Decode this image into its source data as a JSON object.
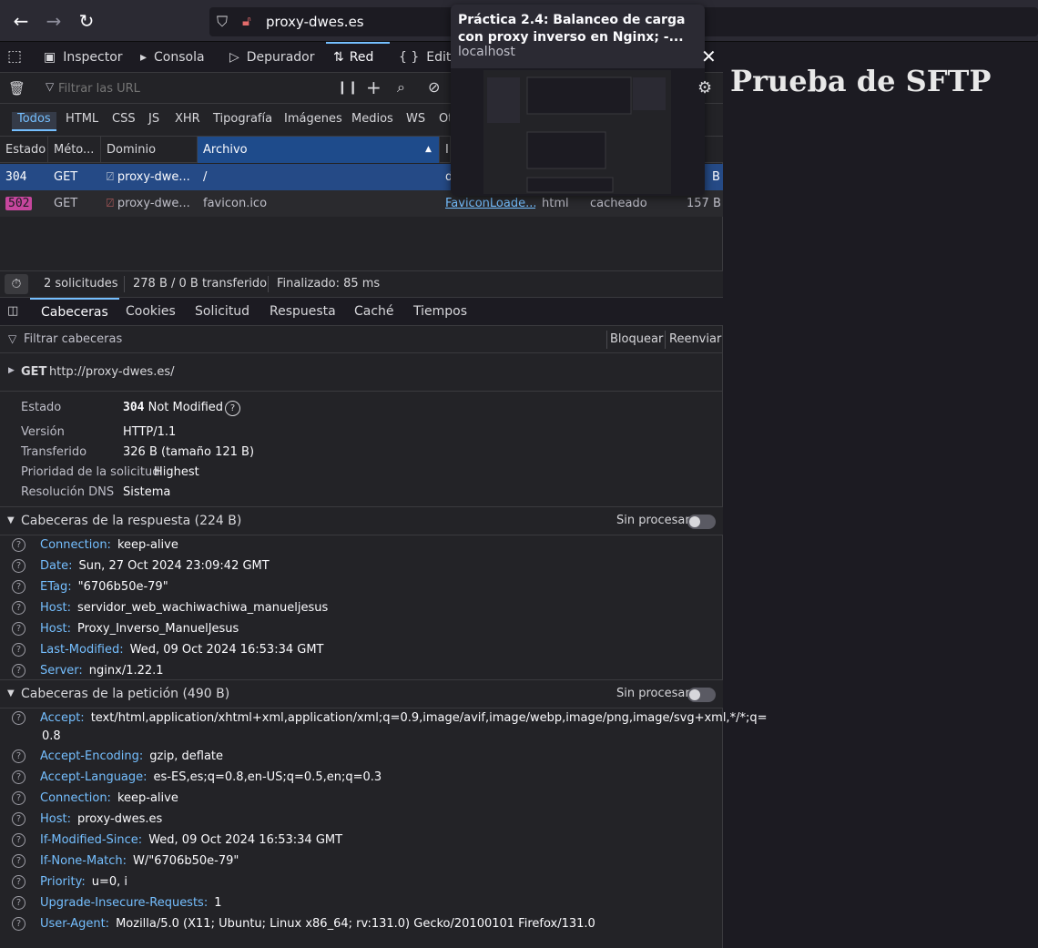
{
  "browser": {
    "url": "proxy-dwes.es",
    "preview": {
      "title": "Práctica 2.4: Balanceo de carga con proxy inverso en Nginx; -...",
      "host": "localhost"
    }
  },
  "page": {
    "title": "Prueba de SFTP"
  },
  "devtools": {
    "tabs": [
      "Inspector",
      "Consola",
      "Depurador",
      "Red",
      "Editor"
    ],
    "filter_placeholder": "Filtrar las URL",
    "types": [
      "Todos",
      "HTML",
      "CSS",
      "JS",
      "XHR",
      "Tipografía",
      "Imágenes",
      "Medios",
      "WS",
      "Otros"
    ],
    "columns": [
      "Estado",
      "Méto...",
      "Dominio",
      "Archivo",
      "In..."
    ],
    "requests": [
      {
        "status": "304",
        "method": "GET",
        "domain": "proxy-dwe...",
        "file": "/",
        "initiator": "d",
        "type": "",
        "transferred": "",
        "size": "B"
      },
      {
        "status": "502",
        "method": "GET",
        "domain": "proxy-dwe...",
        "file": "favicon.ico",
        "initiator": "FaviconLoade...",
        "type": "html",
        "transferred": "cacheado",
        "size": "157 B"
      }
    ],
    "summary": {
      "count": "2 solicitudes",
      "transfer": "278 B / 0 B transferido",
      "finished": "Finalizado: 85 ms"
    },
    "detail_tabs": [
      "Cabeceras",
      "Cookies",
      "Solicitud",
      "Respuesta",
      "Caché",
      "Tiempos"
    ],
    "header_filter": "Filtrar cabeceras",
    "block": "Bloquear",
    "resend": "Reenviar",
    "request_line": {
      "method": "GET",
      "url": "http://proxy-dwes.es/"
    },
    "info": {
      "status_label": "Estado",
      "status_code": "304",
      "status_text": "Not Modified",
      "version_label": "Versión",
      "version": "HTTP/1.1",
      "transferred_label": "Transferido",
      "transferred": "326 B (tamaño 121 B)",
      "priority_label": "Prioridad de la solicitud",
      "priority": "Highest",
      "dns_label": "Resolución DNS",
      "dns": "Sistema"
    },
    "raw_label": "Sin procesar",
    "response_headers_title": "Cabeceras de la respuesta (224 B)",
    "response_headers": [
      {
        "name": "Connection:",
        "value": "keep-alive"
      },
      {
        "name": "Date:",
        "value": "Sun, 27 Oct 2024 23:09:42 GMT"
      },
      {
        "name": "ETag:",
        "value": "\"6706b50e-79\""
      },
      {
        "name": "Host:",
        "value": "servidor_web_wachiwachiwa_manueljesus"
      },
      {
        "name": "Host:",
        "value": "Proxy_Inverso_ManuelJesus"
      },
      {
        "name": "Last-Modified:",
        "value": "Wed, 09 Oct 2024 16:53:34 GMT"
      },
      {
        "name": "Server:",
        "value": "nginx/1.22.1"
      }
    ],
    "request_headers_title": "Cabeceras de la petición (490 B)",
    "request_headers": [
      {
        "name": "Accept:",
        "value": "text/html,application/xhtml+xml,application/xml;q=0.9,image/avif,image/webp,image/png,image/svg+xml,*/*;q=",
        "value2": "0.8"
      },
      {
        "name": "Accept-Encoding:",
        "value": "gzip, deflate"
      },
      {
        "name": "Accept-Language:",
        "value": "es-ES,es;q=0.8,en-US;q=0.5,en;q=0.3"
      },
      {
        "name": "Connection:",
        "value": "keep-alive"
      },
      {
        "name": "Host:",
        "value": "proxy-dwes.es"
      },
      {
        "name": "If-Modified-Since:",
        "value": "Wed, 09 Oct 2024 16:53:34 GMT"
      },
      {
        "name": "If-None-Match:",
        "value": "W/\"6706b50e-79\""
      },
      {
        "name": "Priority:",
        "value": "u=0, i"
      },
      {
        "name": "Upgrade-Insecure-Requests:",
        "value": "1"
      },
      {
        "name": "User-Agent:",
        "value": "Mozilla/5.0 (X11; Ubuntu; Linux x86_64; rv:131.0) Gecko/20100101 Firefox/131.0"
      }
    ]
  }
}
